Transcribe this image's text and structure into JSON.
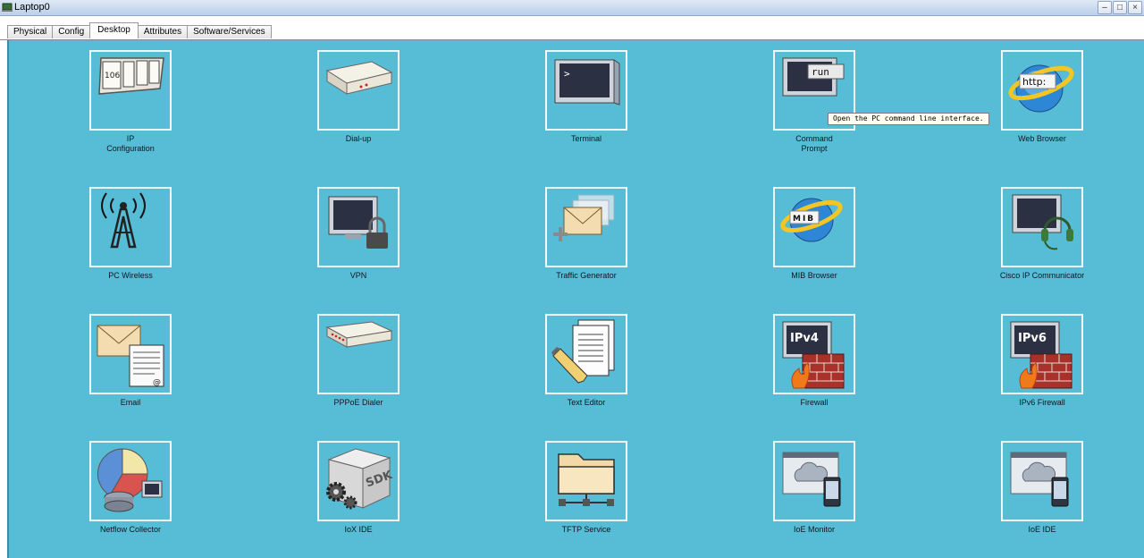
{
  "window": {
    "title": "Laptop0",
    "controls": [
      "minimize",
      "maximize",
      "close"
    ]
  },
  "tabs": [
    {
      "label": "Physical",
      "active": false
    },
    {
      "label": "Config",
      "active": false
    },
    {
      "label": "Desktop",
      "active": true
    },
    {
      "label": "Attributes",
      "active": false
    },
    {
      "label": "Software/Services",
      "active": false
    }
  ],
  "apps": [
    {
      "label": "IP\nConfiguration",
      "icon": "ip-configuration-icon"
    },
    {
      "label": "Dial-up",
      "icon": "modem-icon"
    },
    {
      "label": "Terminal",
      "icon": "terminal-icon"
    },
    {
      "label": "Command\nPrompt",
      "icon": "command-prompt-icon"
    },
    {
      "label": "Web Browser",
      "icon": "web-browser-icon"
    },
    {
      "label": "PC Wireless",
      "icon": "wireless-tower-icon"
    },
    {
      "label": "VPN",
      "icon": "vpn-lock-icon"
    },
    {
      "label": "Traffic Generator",
      "icon": "traffic-generator-icon"
    },
    {
      "label": "MIB Browser",
      "icon": "mib-browser-icon"
    },
    {
      "label": "Cisco IP Communicator",
      "icon": "ip-communicator-icon"
    },
    {
      "label": "Email",
      "icon": "email-icon"
    },
    {
      "label": "PPPoE Dialer",
      "icon": "pppoe-dialer-icon"
    },
    {
      "label": "Text Editor",
      "icon": "text-editor-icon"
    },
    {
      "label": "Firewall",
      "icon": "firewall-icon"
    },
    {
      "label": "IPv6 Firewall",
      "icon": "ipv6-firewall-icon"
    },
    {
      "label": "Netflow Collector",
      "icon": "netflow-collector-icon"
    },
    {
      "label": "IoX IDE",
      "icon": "iox-ide-icon"
    },
    {
      "label": "TFTP Service",
      "icon": "tftp-folder-icon"
    },
    {
      "label": "IoE Monitor",
      "icon": "ioe-monitor-icon"
    },
    {
      "label": "IoE IDE",
      "icon": "ioe-ide-icon"
    }
  ],
  "icon_text": {
    "ip_number": "106",
    "run": "run",
    "http": "http:",
    "mib": "MIB",
    "ipv4": "IPv4",
    "ipv6": "IPv6",
    "sdk": "SDK"
  },
  "tooltip": "Open the PC command line interface.",
  "colors": {
    "desktop_bg": "#57bcd5",
    "frame": "#f2f8fa"
  }
}
